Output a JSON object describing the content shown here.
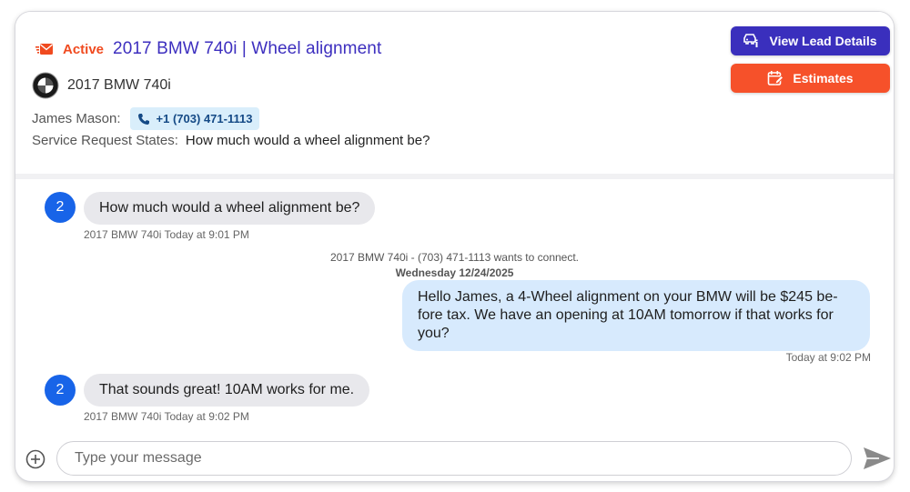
{
  "lead": {
    "status": "Active",
    "title": "2017 BMW 740i | Wheel alignment",
    "vehicle": "2017 BMW 740i",
    "customer_label": "James Mason:",
    "phone": "+1 (703) 471-1113",
    "request_label": "Service Request States:",
    "request_value": "How much would a wheel alignment be?"
  },
  "actions": {
    "view_lead_label": "View Lead Details",
    "estimates_label": "Estimates"
  },
  "colors": {
    "active": "#f04a1f",
    "title": "#3d2fbf",
    "view_lead_button": "#3a2fbd",
    "estimates_button": "#f6512a",
    "avatar": "#1864e8",
    "incoming_bubble": "#e8e8ec",
    "outgoing_bubble": "#d7eafd"
  },
  "messages": [
    {
      "direction": "incoming",
      "avatar": "2",
      "text": "How much would a wheel alignment be?",
      "meta": "2017 BMW 740i Today at 9:01 PM"
    },
    {
      "direction": "system",
      "text": "2017 BMW 740i - (703) 471-1113 wants to connect."
    },
    {
      "direction": "date",
      "text": "Wednesday 12/24/2025"
    },
    {
      "direction": "outgoing",
      "text": "Hello James, a 4-Wheel alignment on your BMW will be $245 be-fore tax. We have an opening at 10AM tomorrow if that works for you?",
      "meta": "Today at 9:02 PM"
    },
    {
      "direction": "incoming",
      "avatar": "2",
      "text": "That sounds great! 10AM works for me.",
      "meta": "2017 BMW 740i Today at 9:02 PM"
    }
  ],
  "composer": {
    "placeholder": "Type your message",
    "value": ""
  },
  "icons": {
    "status": "mail-icon",
    "vehicle": "bmw-logo",
    "phone": "phone-icon",
    "view_lead": "car-info-icon",
    "estimates": "calendar-edit-icon",
    "attach": "plus-circle-icon",
    "send": "send-icon"
  }
}
